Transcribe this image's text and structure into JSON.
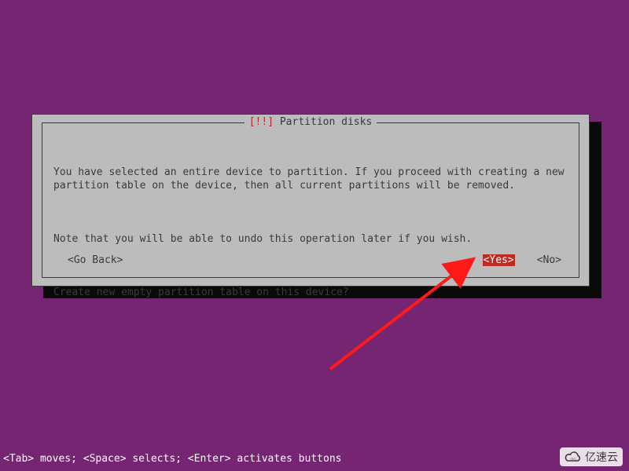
{
  "dialog": {
    "title_bang": "[!!]",
    "title_text": " Partition disks ",
    "para1": "You have selected an entire device to partition. If you proceed with creating a new partition table on the device, then all current partitions will be removed.",
    "para2": "Note that you will be able to undo this operation later if you wish.",
    "question": "Create new empty partition table on this device?",
    "go_back": "<Go Back>",
    "yes": "<Yes>",
    "no": "<No>"
  },
  "status": "<Tab> moves; <Space> selects; <Enter> activates buttons",
  "watermark": "亿速云"
}
